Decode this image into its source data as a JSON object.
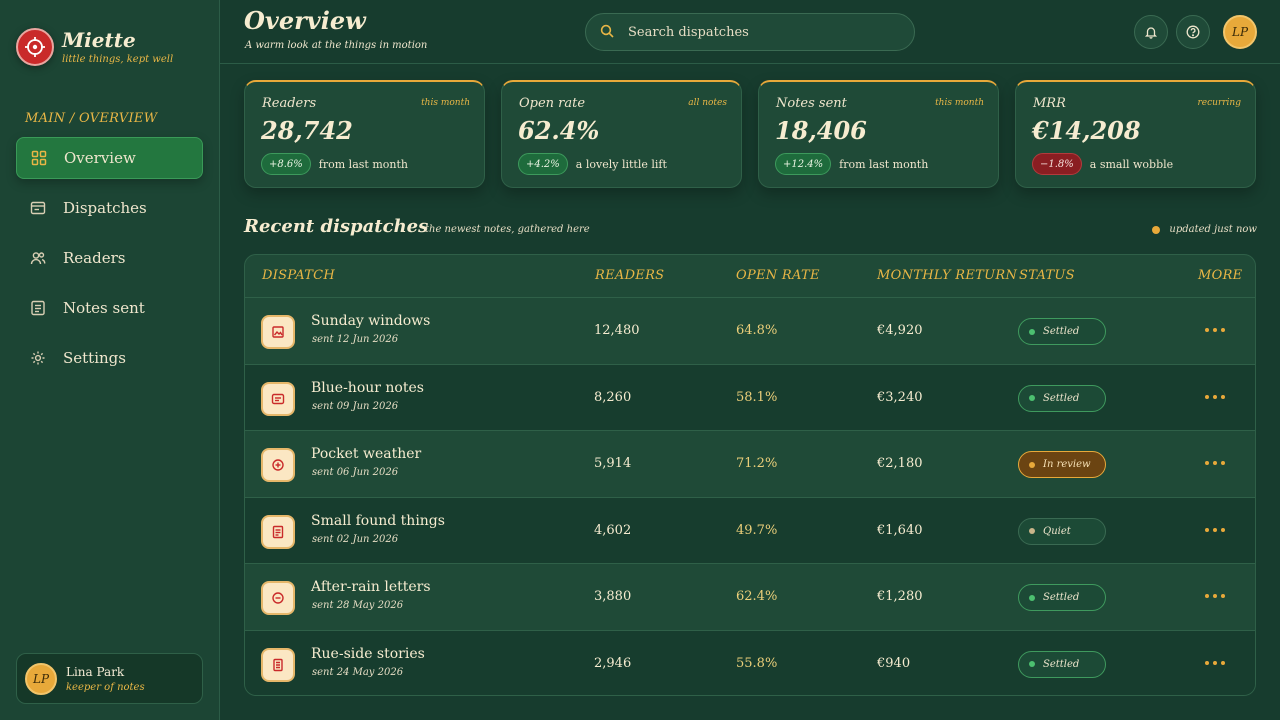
{
  "brand": {
    "name": "Miette",
    "tagline": "little things, kept well"
  },
  "sidebar": {
    "section_label": "MAIN / OVERVIEW",
    "items": [
      {
        "label": "Overview",
        "icon": "grid-icon",
        "active": true
      },
      {
        "label": "Dispatches",
        "icon": "inbox-icon"
      },
      {
        "label": "Readers",
        "icon": "users-icon"
      },
      {
        "label": "Notes sent",
        "icon": "note-icon"
      },
      {
        "label": "Settings",
        "icon": "gear-icon"
      }
    ]
  },
  "user": {
    "initials": "LP",
    "name": "Lina Park",
    "role": "keeper of notes"
  },
  "header": {
    "title": "Overview",
    "subtitle": "A warm look at the things in motion",
    "search_placeholder": "Search dispatches",
    "avatar_initials": "LP"
  },
  "stats": [
    {
      "label": "Readers",
      "period": "this month",
      "value": "28,742",
      "delta": "+8.6%",
      "direction": "up",
      "note": "from last month"
    },
    {
      "label": "Open rate",
      "period": "all notes",
      "value": "62.4%",
      "delta": "+4.2%",
      "direction": "up",
      "note": "a lovely little lift"
    },
    {
      "label": "Notes sent",
      "period": "this month",
      "value": "18,406",
      "delta": "+12.4%",
      "direction": "up",
      "note": "from last month"
    },
    {
      "label": "MRR",
      "period": "recurring",
      "value": "€14,208",
      "delta": "−1.8%",
      "direction": "down",
      "note": "a small wobble"
    }
  ],
  "recent": {
    "title": "Recent dispatches",
    "subtitle": "the newest notes, gathered here",
    "updated": "updated just now",
    "columns": [
      "DISPATCH",
      "READERS",
      "OPEN RATE",
      "MONTHLY RETURN",
      "STATUS",
      "MORE"
    ],
    "rows": [
      {
        "name": "Sunday windows",
        "date": "sent 12 Jun 2026",
        "readers": "12,480",
        "open_rate": "64.8%",
        "return": "€4,920",
        "status": "Settled",
        "kind": "settled"
      },
      {
        "name": "Blue-hour notes",
        "date": "sent 09 Jun 2026",
        "readers": "8,260",
        "open_rate": "58.1%",
        "return": "€3,240",
        "status": "Settled",
        "kind": "settled"
      },
      {
        "name": "Pocket weather",
        "date": "sent 06 Jun 2026",
        "readers": "5,914",
        "open_rate": "71.2%",
        "return": "€2,180",
        "status": "In review",
        "kind": "review"
      },
      {
        "name": "Small found things",
        "date": "sent 02 Jun 2026",
        "readers": "4,602",
        "open_rate": "49.7%",
        "return": "€1,640",
        "status": "Quiet",
        "kind": "quiet"
      },
      {
        "name": "After-rain letters",
        "date": "sent 28 May 2026",
        "readers": "3,880",
        "open_rate": "62.4%",
        "return": "€1,280",
        "status": "Settled",
        "kind": "settled"
      },
      {
        "name": "Rue-side stories",
        "date": "sent 24 May 2026",
        "readers": "2,946",
        "open_rate": "55.8%",
        "return": "€940",
        "status": "Settled",
        "kind": "settled"
      }
    ]
  },
  "colors": {
    "background": "#173c2e",
    "accent": "#e8a93a",
    "active": "#23773f",
    "brand_red": "#c92a2a"
  }
}
